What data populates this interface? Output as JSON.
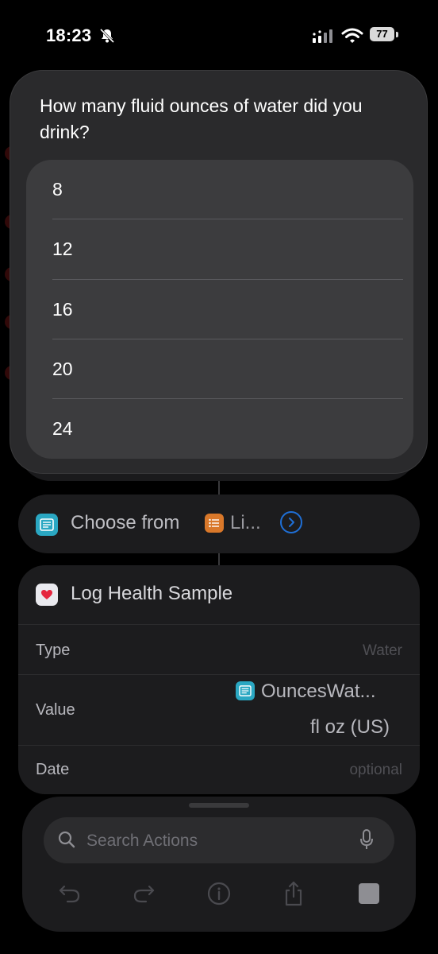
{
  "status_bar": {
    "time": "18:23",
    "battery": "77"
  },
  "prompt": {
    "question": "How many fluid ounces of water did you drink?",
    "options": [
      "8",
      "12",
      "16",
      "20",
      "24"
    ]
  },
  "choose_action": {
    "label": "Choose from",
    "list_label": "Li..."
  },
  "health_action": {
    "title": "Log Health Sample",
    "rows": {
      "type_label": "Type",
      "type_value": "Water",
      "value_label": "Value",
      "value_variable": "OuncesWat...",
      "value_unit": "fl oz (US)",
      "date_label": "Date",
      "date_placeholder": "optional"
    }
  },
  "search": {
    "placeholder": "Search Actions"
  },
  "colors": {
    "accent_blue": "#1f6fd6",
    "badge_blue": "#2aa7c2",
    "badge_orange": "#d9782a",
    "heart_red": "#e5263f"
  }
}
